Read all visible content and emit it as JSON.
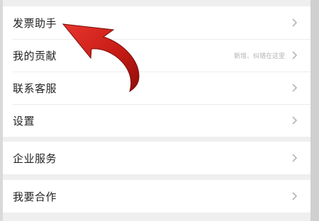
{
  "section1": {
    "items": [
      {
        "label": "发票助手",
        "icon": "chevron-right-icon"
      },
      {
        "label": "我的贡献",
        "hint": "新增、纠错在这里",
        "icon": "chevron-right-icon"
      },
      {
        "label": "联系客服",
        "icon": "chevron-right-icon"
      },
      {
        "label": "设置",
        "icon": "chevron-right-icon"
      }
    ]
  },
  "section2": {
    "items": [
      {
        "label": "企业服务",
        "icon": "chevron-right-icon"
      }
    ]
  },
  "section3": {
    "items": [
      {
        "label": "我要合作",
        "icon": "chevron-right-icon"
      }
    ]
  },
  "annotation": {
    "icon": "curved-arrow-icon",
    "color": "#cc1f1a"
  },
  "colors": {
    "background": "#efefef",
    "card": "#ffffff",
    "text": "#222222",
    "chevron": "#b5b5b5"
  }
}
